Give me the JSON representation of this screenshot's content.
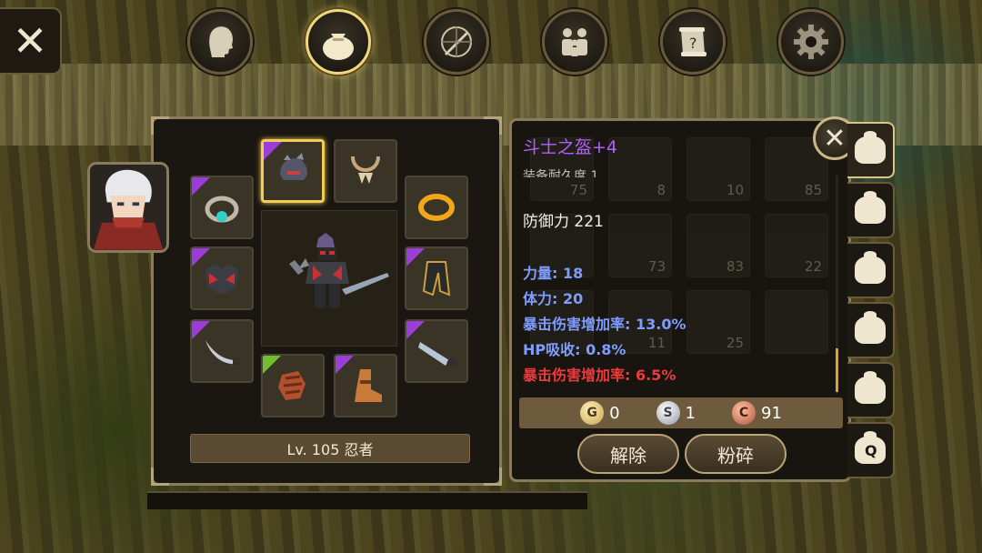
{
  "top_bar": {
    "close_label": "✕",
    "tabs": [
      {
        "icon": "character-head-icon"
      },
      {
        "icon": "bag-icon",
        "active": true
      },
      {
        "icon": "compass-sword-icon"
      },
      {
        "icon": "party-icon"
      },
      {
        "icon": "quest-scroll-icon"
      },
      {
        "icon": "gear-icon"
      }
    ]
  },
  "equipment": {
    "level_text": "Lv. 105 忍者",
    "slots": [
      {
        "name": "helmet",
        "rarity": "purple",
        "selected": true
      },
      {
        "name": "necklace",
        "rarity": "none"
      },
      {
        "name": "ring-left",
        "rarity": "purple"
      },
      {
        "name": "ring-right",
        "rarity": "none"
      },
      {
        "name": "armor",
        "rarity": "purple"
      },
      {
        "name": "cape",
        "rarity": "purple"
      },
      {
        "name": "offhand-blade",
        "rarity": "purple"
      },
      {
        "name": "weapon",
        "rarity": "purple"
      },
      {
        "name": "gloves",
        "rarity": "green"
      },
      {
        "name": "boots",
        "rarity": "purple"
      }
    ]
  },
  "tooltip": {
    "title": "斗士之盔+4",
    "cut_line": "装备耐久度 1",
    "defense": "防御力 221",
    "stats": [
      {
        "text": "力量: 18",
        "color": "blue"
      },
      {
        "text": "体力: 20",
        "color": "blue"
      },
      {
        "text": "暴击伤害增加率: 13.0%",
        "color": "blue"
      },
      {
        "text": "HP吸收: 0.8%",
        "color": "blue"
      },
      {
        "text": "暴击伤害增加率: 6.5%",
        "color": "red"
      }
    ]
  },
  "bag_counts": [
    "75",
    "8",
    "10",
    "85",
    "",
    "73",
    "83",
    "22",
    "",
    "11",
    "25",
    ""
  ],
  "currency": {
    "gold_symbol": "G",
    "gold": "0",
    "silver_symbol": "S",
    "silver": "1",
    "copper_symbol": "C",
    "copper": "91"
  },
  "actions": {
    "unequip": "解除",
    "smash": "粉碎"
  },
  "info_close_label": "✕",
  "side_tabs": [
    "bag-1",
    "bag-2",
    "bag-3",
    "bag-4",
    "bag-5",
    "bag-quest"
  ],
  "colors": {
    "rarity_purple": "#9a3ed9",
    "rarity_green": "#6fbf30",
    "title_purple": "#b060ff",
    "stat_blue": "#7f9dff",
    "stat_red": "#ec3b3b",
    "selected_gold": "#f2cc55"
  }
}
